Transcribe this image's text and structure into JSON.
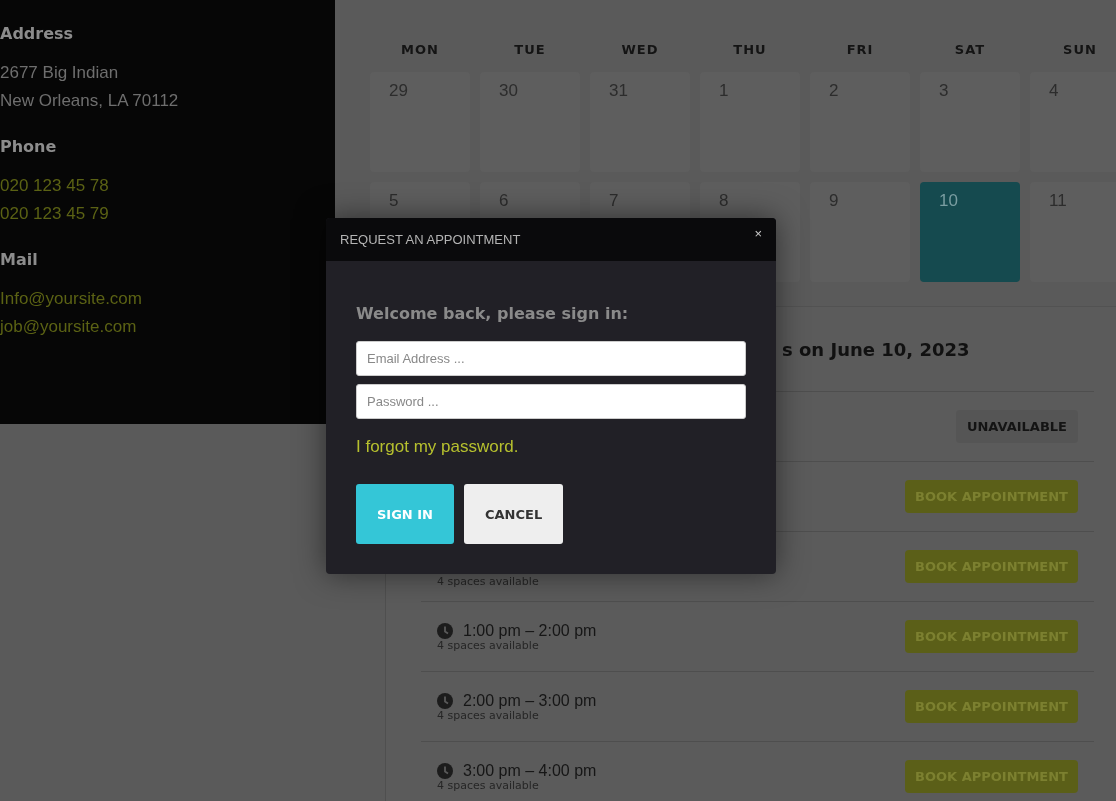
{
  "contact": [
    {
      "label": "Address",
      "kind": "text",
      "lines": [
        "2677 Big Indian",
        "New Orleans, LA 70112"
      ]
    },
    {
      "label": "Phone",
      "kind": "link",
      "lines": [
        "020 123 45 78",
        "020 123 45 79"
      ]
    },
    {
      "label": "Mail",
      "kind": "link",
      "lines": [
        "Info@yoursite.com",
        "job@yoursite.com"
      ]
    }
  ],
  "calendar": {
    "weekdays": [
      "MON",
      "TUE",
      "WED",
      "THU",
      "FRI",
      "SAT",
      "SUN"
    ],
    "days": [
      {
        "label": "29",
        "selected": false
      },
      {
        "label": "30",
        "selected": false
      },
      {
        "label": "31",
        "selected": false
      },
      {
        "label": "1",
        "selected": false
      },
      {
        "label": "2",
        "selected": false
      },
      {
        "label": "3",
        "selected": false
      },
      {
        "label": "4",
        "selected": false
      },
      {
        "label": "5",
        "selected": false
      },
      {
        "label": "6",
        "selected": false
      },
      {
        "label": "7",
        "selected": false
      },
      {
        "label": "8",
        "selected": false
      },
      {
        "label": "9",
        "selected": false
      },
      {
        "label": "10",
        "selected": true
      },
      {
        "label": "11",
        "selected": false
      }
    ]
  },
  "slots": {
    "heading": "s on June 10, 2023",
    "rows": [
      {
        "kind": "unavailable",
        "action": "UNAVAILABLE"
      },
      {
        "kind": "book",
        "action": "BOOK APPOINTMENT"
      },
      {
        "kind": "book",
        "spaces": "4 spaces available",
        "action": "BOOK APPOINTMENT"
      },
      {
        "kind": "book",
        "time": "1:00 pm – 2:00 pm",
        "spaces": "4 spaces available",
        "action": "BOOK APPOINTMENT"
      },
      {
        "kind": "book",
        "time": "2:00 pm – 3:00 pm",
        "spaces": "4 spaces available",
        "action": "BOOK APPOINTMENT"
      },
      {
        "kind": "book",
        "time": "3:00 pm – 4:00 pm",
        "spaces": "4 spaces available",
        "action": "BOOK APPOINTMENT"
      }
    ]
  },
  "modal": {
    "title": "REQUEST AN APPOINTMENT",
    "close": "×",
    "prompt": "Welcome back, please sign in:",
    "fields": [
      {
        "placeholder": "Email Address ..."
      },
      {
        "placeholder": "Password ..."
      }
    ],
    "forgot_link": "I forgot my password.",
    "buttons": [
      {
        "label": "SIGN IN",
        "kind": "primary"
      },
      {
        "label": "CANCEL",
        "kind": "secondary"
      }
    ]
  }
}
